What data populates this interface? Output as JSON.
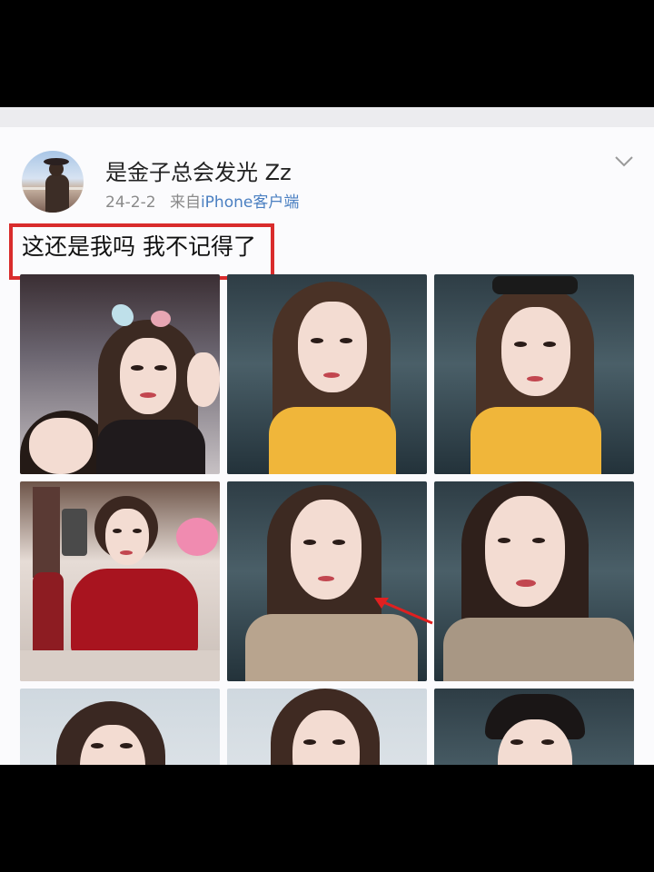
{
  "post": {
    "username": "是金子总会发光 Zz",
    "time": "24-2-2",
    "from_prefix": "来自",
    "client": "iPhone客户端",
    "text": "这还是我吗 我不记得了"
  },
  "icons": {
    "menu": "chevron-down-icon",
    "avatar": "avatar"
  },
  "photos": [
    {
      "id": "photo-1",
      "scene": "group selfie"
    },
    {
      "id": "photo-2",
      "scene": "car selfie yellow top"
    },
    {
      "id": "photo-3",
      "scene": "car selfie sunglasses on head"
    },
    {
      "id": "photo-4",
      "scene": "mirror selfie red dress"
    },
    {
      "id": "photo-5",
      "scene": "car selfie plaid jacket"
    },
    {
      "id": "photo-6",
      "scene": "car selfie plaid jacket close-up"
    },
    {
      "id": "photo-7",
      "scene": "portrait"
    },
    {
      "id": "photo-8",
      "scene": "portrait"
    },
    {
      "id": "photo-9",
      "scene": "car selfie headscarf"
    }
  ],
  "colors": {
    "highlight": "#d92c2c",
    "link": "#4a7fc1",
    "annotation_arrow": "#e02020"
  }
}
